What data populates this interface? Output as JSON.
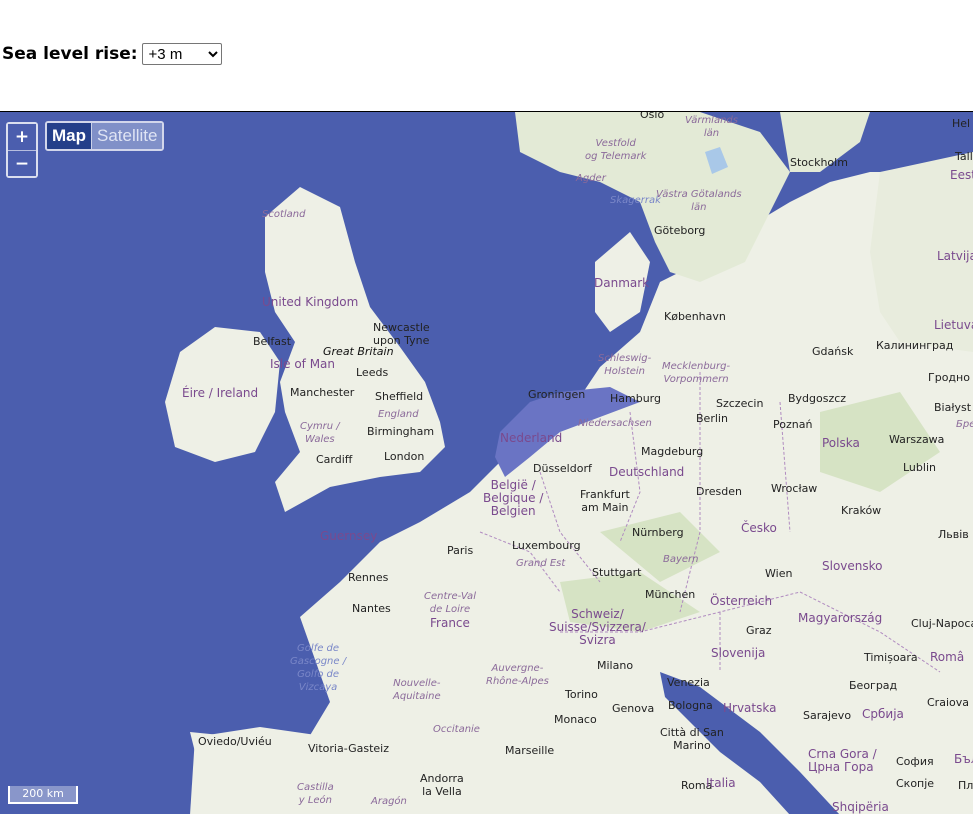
{
  "control": {
    "label": "Sea level rise:",
    "selected": "+3 m"
  },
  "map": {
    "zoom_in": "+",
    "zoom_out": "−",
    "layers": {
      "map": "Map",
      "satellite": "Satellite"
    },
    "scale": "200 km",
    "labels": {
      "oslo": "Oslo",
      "varmlands": "Värmlands\nlän",
      "vestfold": "Vestfold\nog Telemark",
      "agder": "Agder",
      "skagerrak": "Skagerrak",
      "vastra": "Västra Götalands\nlän",
      "goteborg": "Göteborg",
      "stockholm": "Stockholm",
      "tallinn": "Talli",
      "eesti": "Eest",
      "hel": "Hel",
      "latvija": "Latvija",
      "lietuva": "Lietuva",
      "scotland": "Scotland",
      "danmark": "Danmark",
      "kobenhavn": "København",
      "gdansk": "Gdańsk",
      "kaliningrad": "Калининград",
      "grodno": "Гродно",
      "bialystok": "Białyst",
      "united_kingdom": "United Kingdom",
      "newcastle": "Newcastle\nupon Tyne",
      "great_britain": "Great Britain",
      "belfast": "Belfast",
      "isle_of_man": "Isle of Man",
      "schleswig": "Schleswig-\nHolstein",
      "mecklenburg": "Mecklenburg-\nVorpommern",
      "leeds": "Leeds",
      "eire": "Éire / Ireland",
      "manchester": "Manchester",
      "sheffield": "Sheffield",
      "groningen": "Groningen",
      "hamburg": "Hamburg",
      "szczecin": "Szczecin",
      "bydgoszcz": "Bydgoszcz",
      "england": "England",
      "cymru": "Cymru /\nWales",
      "birmingham": "Birmingham",
      "niedersachsen": "Niedersachsen",
      "berlin": "Berlin",
      "poznan": "Poznań",
      "warszawa": "Warszawa",
      "nederland": "Nederland",
      "polska": "Polska",
      "cardiff": "Cardiff",
      "london": "London",
      "magdeburg": "Magdeburg",
      "bpe": "Бре",
      "dusseldorf": "Düsseldorf",
      "deutschland": "Deutschland",
      "lublin": "Lublin",
      "belgie": "België /\nBelgique /\nBelgien",
      "frankfurt": "Frankfurt\nam Main",
      "dresden": "Dresden",
      "wroclaw": "Wrocław",
      "krakow": "Kraków",
      "cesko": "Česko",
      "lviv": "Львів",
      "guernsey": "Guernsey",
      "luxembourg": "Luxembourg",
      "nurnberg": "Nürnberg",
      "paris": "Paris",
      "bayern": "Bayern",
      "grand_est": "Grand Est",
      "stuttgart": "Stuttgart",
      "wien": "Wien",
      "slovensko": "Slovensko",
      "rennes": "Rennes",
      "munchen": "München",
      "osterreich": "Österreich",
      "centre": "Centre-Val\nde Loire",
      "nantes": "Nantes",
      "schweiz": "Schweiz/\nSuisse/Svizzera/\nSvizra",
      "magyarorszag": "Magyarország",
      "cluj": "Cluj-Napoca",
      "france": "France",
      "graz": "Graz",
      "golfe": "Golfe de\nGascogne /\nGolfo de\nVizcaya",
      "slovenija": "Slovenija",
      "timisoara": "Timișoara",
      "romania": "Româ",
      "milano": "Milano",
      "auvergne": "Auvergne-\nRhône-Alpes",
      "venezia": "Venezia",
      "nouvelle": "Nouvelle-\nAquitaine",
      "beograd": "Београд",
      "craiova": "Craiova",
      "torino": "Torino",
      "genova": "Genova",
      "bologna": "Bologna",
      "hrvatska": "Hrvatska",
      "monaco": "Monaco",
      "sarajevo": "Sarajevo",
      "srbija": "Србија",
      "occitanie": "Occitanie",
      "oviedo": "Oviedo/Uviéu",
      "citta": "Città di San\nMarino",
      "vitoria": "Vitoria-Gasteiz",
      "marseille": "Marseille",
      "crna": "Crna Gora /\nЦрна Гора",
      "sofia": "София",
      "bulg": "Бъл",
      "andorra": "Andorra\nla Vella",
      "castilla": "Castilla\ny León",
      "aragon": "Aragón",
      "roma": "Roma",
      "italia": "Italia",
      "skopje": "Скопје",
      "plovdiv": "Пло",
      "shqiperia": "Shqipëria"
    }
  }
}
